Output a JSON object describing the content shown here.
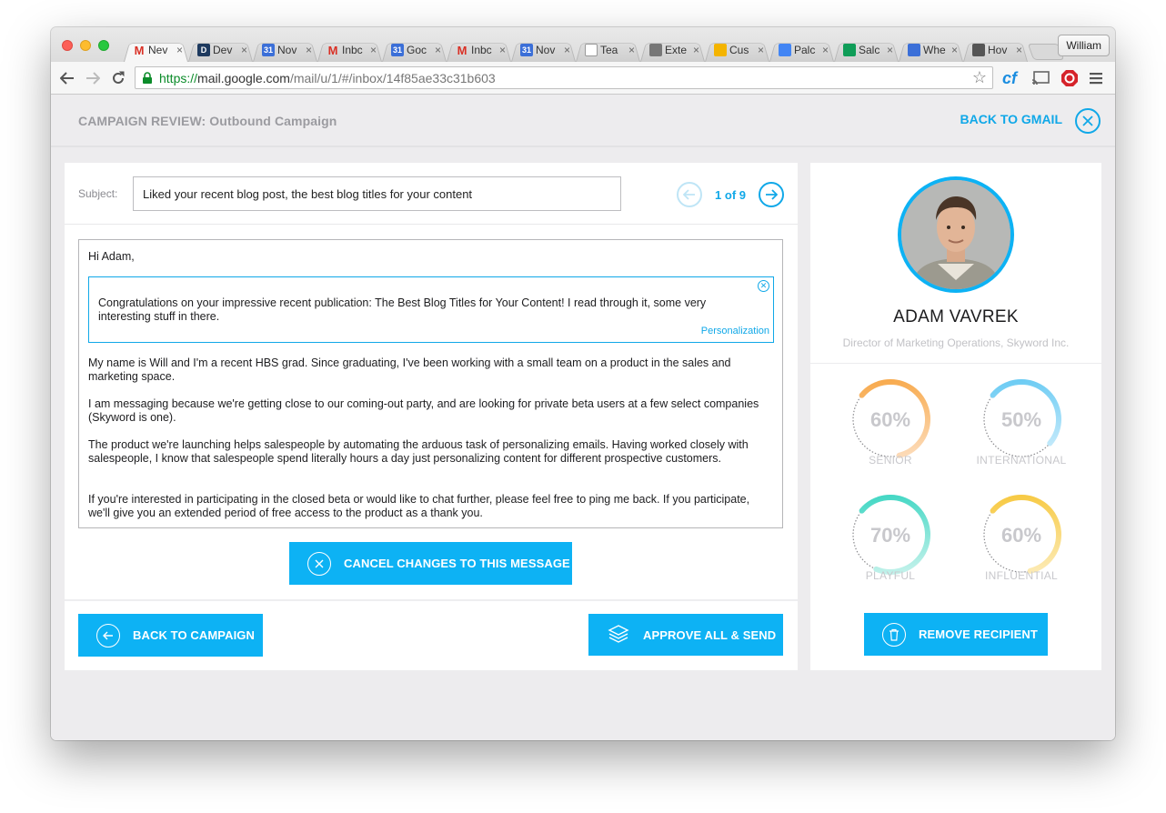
{
  "browser": {
    "tabs": [
      {
        "label": "Nev",
        "icon": "gmail-icon",
        "color": "#d93025",
        "glyph": "M",
        "active": true
      },
      {
        "label": "Dev",
        "icon": "d-icon",
        "color": "#1e3a5f",
        "glyph": "D"
      },
      {
        "label": "Nov",
        "icon": "calendar-icon",
        "color": "#3b6fd8",
        "glyph": "31"
      },
      {
        "label": "Inbc",
        "icon": "gmail-icon",
        "color": "#d93025",
        "glyph": "M"
      },
      {
        "label": "Goc",
        "icon": "calendar-icon",
        "color": "#3b6fd8",
        "glyph": "31"
      },
      {
        "label": "Inbc",
        "icon": "gmail-icon",
        "color": "#d93025",
        "glyph": "M"
      },
      {
        "label": "Nov",
        "icon": "calendar-icon",
        "color": "#3b6fd8",
        "glyph": "31"
      },
      {
        "label": "Tea",
        "icon": "page-icon",
        "color": "#ffffff",
        "glyph": ""
      },
      {
        "label": "Exte",
        "icon": "puzzle-icon",
        "color": "#777777",
        "glyph": ""
      },
      {
        "label": "Cus",
        "icon": "drive-icon",
        "color": "#f4b400",
        "glyph": ""
      },
      {
        "label": "Palc",
        "icon": "docs-icon",
        "color": "#4285f4",
        "glyph": ""
      },
      {
        "label": "Salc",
        "icon": "sheets-icon",
        "color": "#0f9d58",
        "glyph": ""
      },
      {
        "label": "Whe",
        "icon": "circle-icon",
        "color": "#3b6fd8",
        "glyph": ""
      },
      {
        "label": "Hov",
        "icon": "apple-icon",
        "color": "#555555",
        "glyph": ""
      }
    ],
    "tab_close": "×",
    "profile_name": "William",
    "url_https": "https://",
    "url_host": "mail.google.com",
    "url_path": "/mail/u/1/#/inbox/14f85ae33c31b603",
    "ext_cf": "cf"
  },
  "header": {
    "campaign_title": "CAMPAIGN REVIEW: Outbound Campaign",
    "back_to_gmail": "BACK TO GMAIL"
  },
  "message": {
    "subject_label": "Subject:",
    "subject_value": "Liked your recent blog post, the best blog titles for your content",
    "pager_text": "1 of 9",
    "greeting": "Hi Adam,",
    "personalization_text": "Congratulations on your impressive recent publication: The Best Blog Titles for Your Content! I read through it, some very interesting stuff in there.",
    "personalization_tag": "Personalization",
    "paragraphs": [
      "My name is Will and I'm a recent HBS grad. Since graduating, I've been working with a small team on a product in the sales and marketing space.",
      "I am messaging because we're getting close to our coming-out party, and are looking for private beta users at a few select companies (Skyword is one).",
      "The product we're launching helps salespeople by automating the arduous task of personalizing emails. Having worked closely with salespeople, I know that salespeople spend literally hours a day just personalizing content for different prospective customers.",
      "If you're interested in participating in the closed beta or would like to chat further, please feel free to ping me back. If you participate, we'll give you an extended period of free access to the product as a thank you."
    ],
    "cancel_label": "CANCEL CHANGES TO THIS MESSAGE",
    "back_label": "BACK TO CAMPAIGN",
    "approve_label": "APPROVE ALL & SEND"
  },
  "recipient": {
    "name": "ADAM VAVREK",
    "title": "Director of Marketing Operations, Skyword Inc.",
    "traits": [
      {
        "label": "SENIOR",
        "value": 60,
        "display": "60%",
        "color_start": "#fde4cc",
        "color_end": "#f7a23c"
      },
      {
        "label": "INTERNATIONAL",
        "value": 50,
        "display": "50%",
        "color_start": "#dff3fd",
        "color_end": "#5cc6f2"
      },
      {
        "label": "PLAYFUL",
        "value": 70,
        "display": "70%",
        "color_start": "#d8f6f1",
        "color_end": "#2fd3be"
      },
      {
        "label": "INFLUENTIAL",
        "value": 60,
        "display": "60%",
        "color_start": "#fdf0c8",
        "color_end": "#f6c431"
      }
    ],
    "remove_label": "REMOVE RECIPIENT"
  },
  "colors": {
    "accent": "#0db2f4"
  }
}
